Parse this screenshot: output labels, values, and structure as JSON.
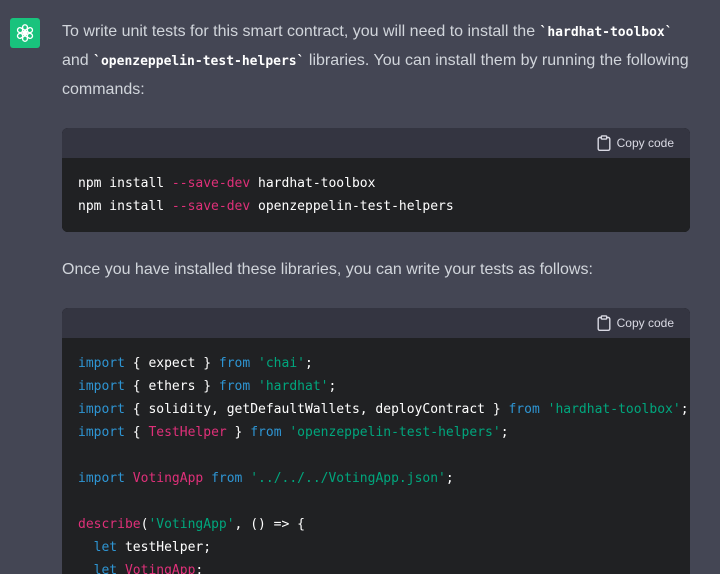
{
  "message": {
    "intro_before": "To write unit tests for this smart contract, you will need to install the ",
    "intro_code1": "`hardhat-toolbox`",
    "intro_and": " and ",
    "intro_code2": "`openzeppelin-test-helpers`",
    "intro_after": " libraries. You can install them by running the following commands:",
    "outro": "Once you have installed these libraries, you can write your tests as follows:"
  },
  "code_blocks": [
    {
      "copy_label": "Copy code",
      "lines": [
        [
          {
            "t": "npm install ",
            "c": "pl"
          },
          {
            "t": "--save-dev",
            "c": "red"
          },
          {
            "t": " hardhat-toolbox",
            "c": "pl"
          }
        ],
        [
          {
            "t": "npm install ",
            "c": "pl"
          },
          {
            "t": "--save-dev",
            "c": "red"
          },
          {
            "t": " openzeppelin-test-helpers",
            "c": "pl"
          }
        ]
      ]
    },
    {
      "copy_label": "Copy code",
      "lines": [
        [
          {
            "t": "import",
            "c": "kw"
          },
          {
            "t": " { expect } ",
            "c": "pl"
          },
          {
            "t": "from",
            "c": "kw"
          },
          {
            "t": " ",
            "c": "pl"
          },
          {
            "t": "'chai'",
            "c": "str"
          },
          {
            "t": ";",
            "c": "pl"
          }
        ],
        [
          {
            "t": "import",
            "c": "kw"
          },
          {
            "t": " { ethers } ",
            "c": "pl"
          },
          {
            "t": "from",
            "c": "kw"
          },
          {
            "t": " ",
            "c": "pl"
          },
          {
            "t": "'hardhat'",
            "c": "str"
          },
          {
            "t": ";",
            "c": "pl"
          }
        ],
        [
          {
            "t": "import",
            "c": "kw"
          },
          {
            "t": " { solidity, getDefaultWallets, deployContract } ",
            "c": "pl"
          },
          {
            "t": "from",
            "c": "kw"
          },
          {
            "t": " ",
            "c": "pl"
          },
          {
            "t": "'hardhat-toolbox'",
            "c": "str"
          },
          {
            "t": ";",
            "c": "pl"
          }
        ],
        [
          {
            "t": "import",
            "c": "kw"
          },
          {
            "t": " { ",
            "c": "pl"
          },
          {
            "t": "TestHelper",
            "c": "red"
          },
          {
            "t": " } ",
            "c": "pl"
          },
          {
            "t": "from",
            "c": "kw"
          },
          {
            "t": " ",
            "c": "pl"
          },
          {
            "t": "'openzeppelin-test-helpers'",
            "c": "str"
          },
          {
            "t": ";",
            "c": "pl"
          }
        ],
        [],
        [
          {
            "t": "import",
            "c": "kw"
          },
          {
            "t": " ",
            "c": "pl"
          },
          {
            "t": "VotingApp",
            "c": "red"
          },
          {
            "t": " ",
            "c": "pl"
          },
          {
            "t": "from",
            "c": "kw"
          },
          {
            "t": " ",
            "c": "pl"
          },
          {
            "t": "'../../../VotingApp.json'",
            "c": "str"
          },
          {
            "t": ";",
            "c": "pl"
          }
        ],
        [],
        [
          {
            "t": "describe",
            "c": "red"
          },
          {
            "t": "(",
            "c": "pl"
          },
          {
            "t": "'VotingApp'",
            "c": "str"
          },
          {
            "t": ", () => {",
            "c": "pl"
          }
        ],
        [
          {
            "t": "  ",
            "c": "pl"
          },
          {
            "t": "let",
            "c": "kw"
          },
          {
            "t": " testHelper;",
            "c": "pl"
          }
        ],
        [
          {
            "t": "  ",
            "c": "pl"
          },
          {
            "t": "let",
            "c": "kw"
          },
          {
            "t": " ",
            "c": "pl"
          },
          {
            "t": "VotingApp",
            "c": "red"
          },
          {
            "t": ";",
            "c": "pl"
          }
        ]
      ]
    }
  ],
  "icons": {
    "avatar": "openai-logo-icon",
    "copy": "clipboard-icon"
  },
  "colors": {
    "page_bg": "#444654",
    "avatar_bg": "#19c37d",
    "code_bg": "#202123",
    "code_header_bg": "#343541",
    "keyword": "#2e95d3",
    "string": "#00a67d",
    "identifier_red": "#df3079",
    "prose": "#d1d5db"
  }
}
